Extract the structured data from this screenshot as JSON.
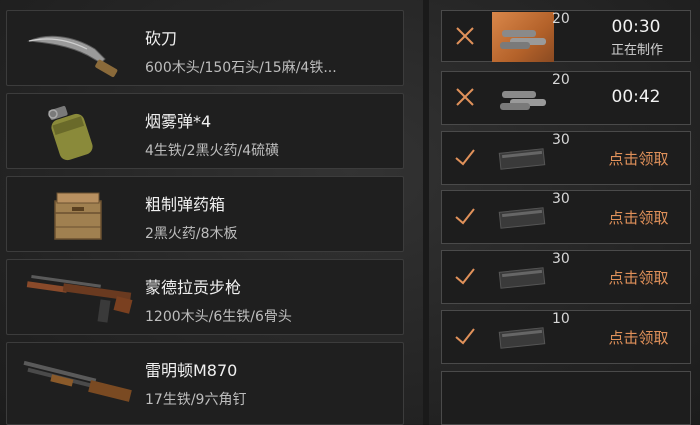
{
  "recipes": [
    {
      "name": "砍刀",
      "cost": "600木头/150石头/15麻/4铁...",
      "icon": "machete-icon"
    },
    {
      "name": "烟雾弹*4",
      "cost": "4生铁/2黑火药/4硫磺",
      "icon": "smoke-grenade-icon"
    },
    {
      "name": "粗制弹药箱",
      "cost": "2黑火药/8木板",
      "icon": "ammo-crate-icon"
    },
    {
      "name": "蒙德拉贡步枪",
      "cost": "1200木头/6生铁/6骨头",
      "icon": "rifle-icon"
    },
    {
      "name": "雷明顿M870",
      "cost": "17生铁/9六角钉",
      "icon": "shotgun-icon"
    }
  ],
  "queue": [
    {
      "state": "in-progress",
      "count": "20",
      "time": "00:30",
      "status": "正在制作",
      "icon": "cancel-x-icon",
      "item": "pipes-icon"
    },
    {
      "state": "queued",
      "count": "20",
      "time": "00:42",
      "icon": "cancel-x-icon",
      "item": "pipes-icon"
    },
    {
      "state": "done",
      "count": "30",
      "claim": "点击领取",
      "icon": "checkmark-icon",
      "item": "magazine-icon"
    },
    {
      "state": "done",
      "count": "30",
      "claim": "点击领取",
      "icon": "checkmark-icon",
      "item": "magazine-icon"
    },
    {
      "state": "done",
      "count": "30",
      "claim": "点击领取",
      "icon": "checkmark-icon",
      "item": "magazine-icon"
    },
    {
      "state": "done",
      "count": "10",
      "claim": "点击领取",
      "icon": "checkmark-icon",
      "item": "magazine-icon"
    },
    {
      "state": "empty"
    }
  ],
  "colors": {
    "accent_orange": "#e0915a",
    "active_thumb": "#c9743a",
    "panel_bg": "#1f1f1f",
    "border": "#3c3c3c"
  }
}
